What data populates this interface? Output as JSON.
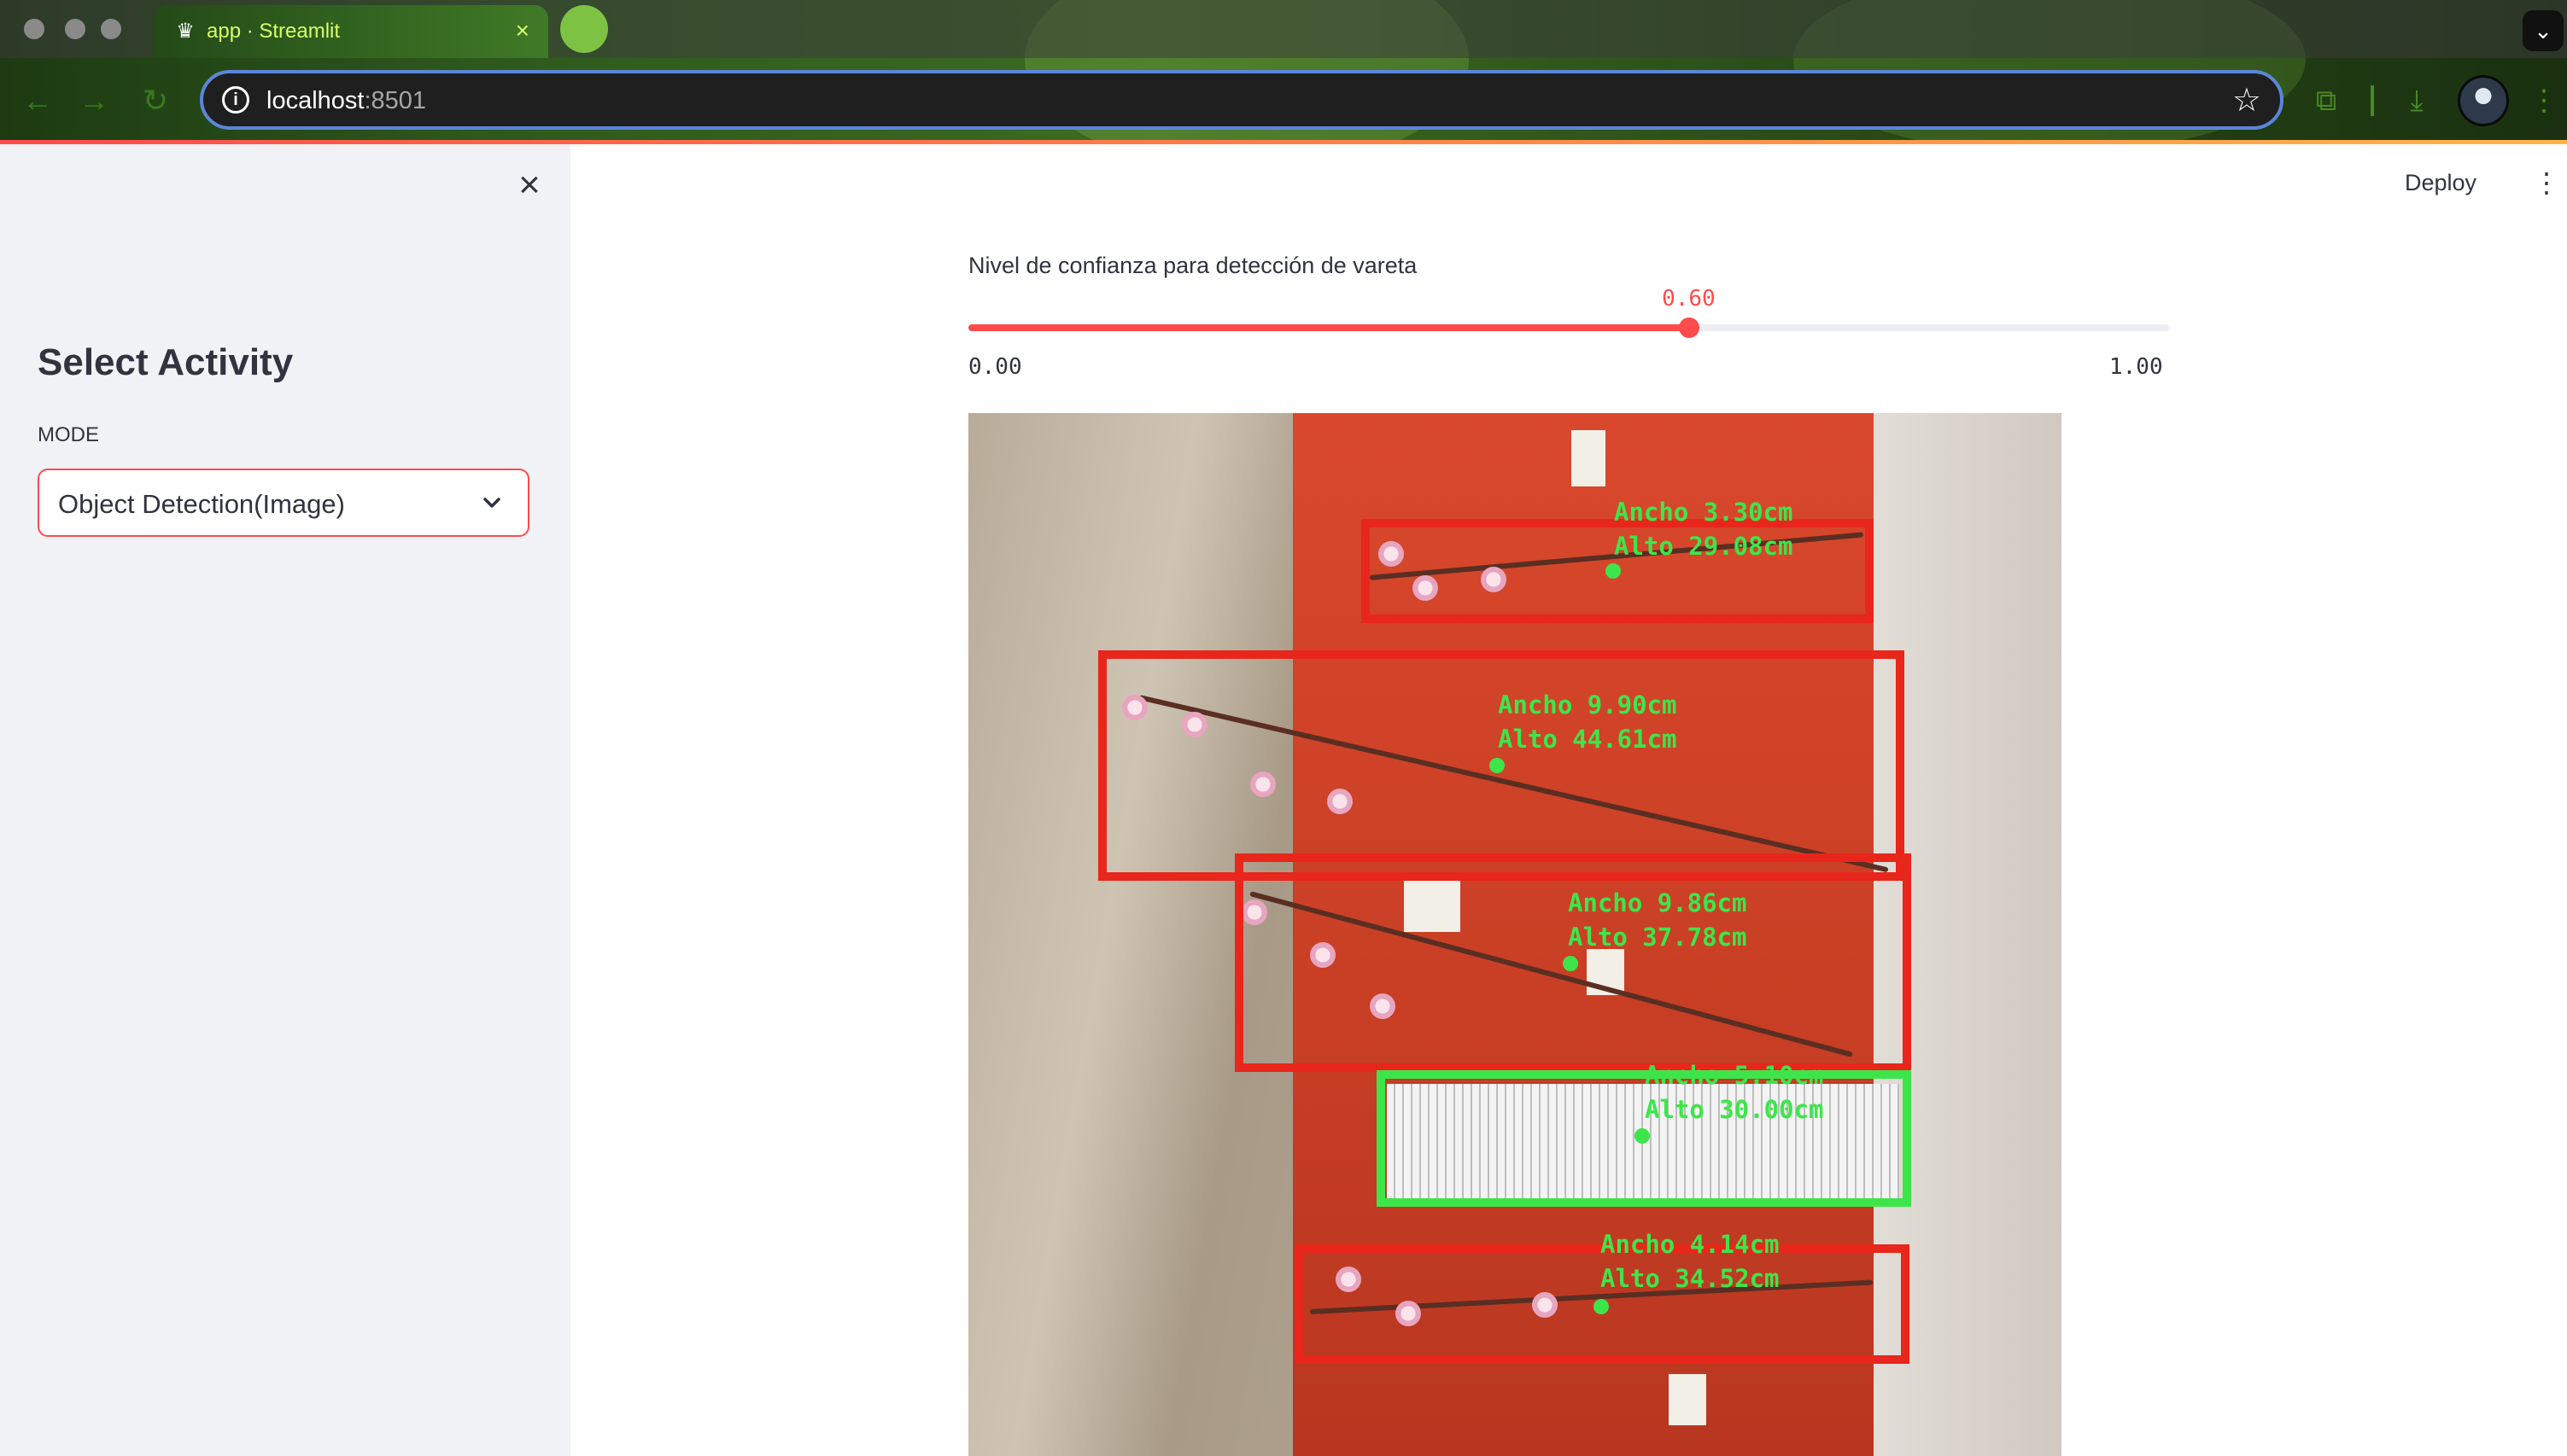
{
  "browser": {
    "tab_title": "app · Streamlit",
    "tab_close": "×",
    "url_host": "localhost",
    "url_port": ":8501"
  },
  "sidebar": {
    "close_glyph": "×",
    "title": "Select Activity",
    "mode_label": "MODE",
    "mode_value": "Object Detection(Image)"
  },
  "header": {
    "deploy_label": "Deploy",
    "menu_glyph": "⋮"
  },
  "slider": {
    "label": "Nivel de confianza para detección de vareta",
    "value": 0.6,
    "value_text": "0.60",
    "min_text": "0.00",
    "max_text": "1.00",
    "min": 0,
    "max": 1
  },
  "detections": [
    {
      "class": "vareta",
      "ancho": "Ancho 3.30cm",
      "alto": "Alto 29.08cm"
    },
    {
      "class": "vareta",
      "ancho": "Ancho 9.90cm",
      "alto": "Alto 44.61cm"
    },
    {
      "class": "vareta",
      "ancho": "Ancho 9.86cm",
      "alto": "Alto 37.78cm"
    },
    {
      "class": "regla",
      "ancho": "Ancho 5.10cm",
      "alto": "Alto 30.00cm"
    },
    {
      "class": "vareta",
      "ancho": "Ancho 4.14cm",
      "alto": "Alto 34.52cm"
    }
  ],
  "colors": {
    "accent": "#ff4b4b",
    "detection_box": "#e8261b",
    "reference_box": "#3ce64a",
    "label_text": "#3ce64a"
  },
  "icons": [
    "crown-icon",
    "back-icon",
    "forward-icon",
    "reload-icon",
    "info-icon",
    "star-icon",
    "extensions-icon",
    "download-icon",
    "profile-avatar",
    "more-icon",
    "close-icon",
    "chevron-down-icon"
  ]
}
